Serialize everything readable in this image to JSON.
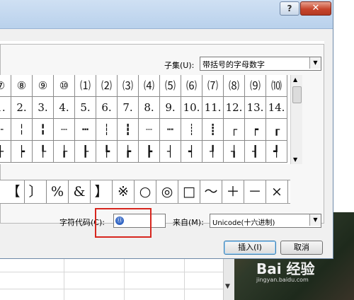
{
  "dialog": {
    "help_label": "?",
    "close_label": "✕",
    "subset_label": "子集(U):",
    "subset_value": "带括号的字母数字",
    "char_code_label": "字符代码(C):",
    "char_code_value": "⑬",
    "from_label": "来自(M):",
    "from_value": "Unicode(十六进制)",
    "insert_label": "插入(I)",
    "cancel_label": "取消"
  },
  "grid": {
    "rows": [
      [
        "⑦",
        "⑧",
        "⑨",
        "⑩",
        "⑴",
        "⑵",
        "⑶",
        "⑷",
        "⑸",
        "⑹",
        "⑺",
        "⑻",
        "⑼",
        "⑽"
      ],
      [
        "1.",
        "2.",
        "3.",
        "4.",
        "5.",
        "6.",
        "7.",
        "8.",
        "9.",
        "10.",
        "11.",
        "12.",
        "13.",
        "14."
      ],
      [
        "╌",
        "╎",
        "╏",
        "┄",
        "┅",
        "┆",
        "┇",
        "┈",
        "┉",
        "┊",
        "┋",
        "┌",
        "┍",
        "┎"
      ],
      [
        "├",
        "┝",
        "┞",
        "┟",
        "┠",
        "┡",
        "┢",
        "┣",
        "┤",
        "┥",
        "┦",
        "┧",
        "┨",
        "┩"
      ]
    ]
  },
  "recent": [
    "【",
    "〕",
    "%",
    "&",
    "】",
    "※",
    "○",
    "◎",
    "□",
    "～",
    "＋",
    "－",
    "×"
  ],
  "watermark": {
    "main": "Bai 经验",
    "sub": "jingyan.baidu.com"
  },
  "icons": {
    "dropdown": "chevron-down-icon",
    "scroll_up": "arrow-up-icon",
    "scroll_down": "arrow-down-icon"
  }
}
